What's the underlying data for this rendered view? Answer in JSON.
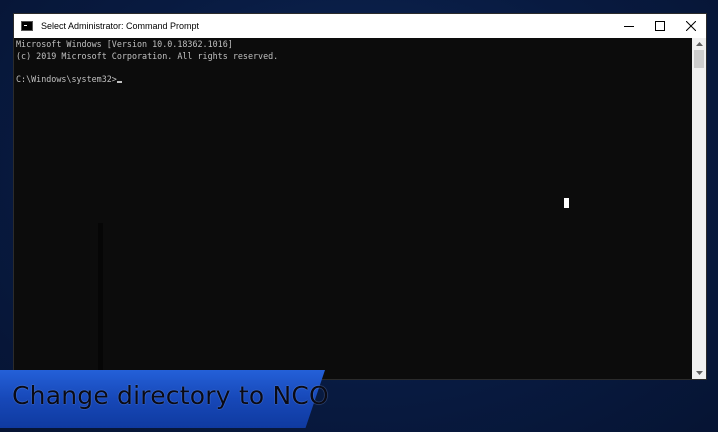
{
  "window": {
    "title": "Select Administrator: Command Prompt",
    "minimize_glyph": "—",
    "maximize_glyph": "☐",
    "close_glyph": "✕"
  },
  "console": {
    "lines": [
      "Microsoft Windows [Version 10.0.18362.1016]",
      "(c) 2019 Microsoft Corporation. All rights reserved.",
      ""
    ],
    "prompt": "C:\\Windows\\system32>"
  },
  "overlay": {
    "caption": "Change directory to NCO"
  },
  "colors": {
    "console_bg": "#0c0c0c",
    "console_fg": "#c0c0c0",
    "titlebar_bg": "#ffffff",
    "banner_blue": "#1748b8"
  },
  "icons": {
    "app_icon": "cmd-icon",
    "minimize": "minimize-icon",
    "maximize": "maximize-icon",
    "close": "close-icon",
    "scroll_up": "chevron-up-icon",
    "scroll_down": "chevron-down-icon"
  }
}
